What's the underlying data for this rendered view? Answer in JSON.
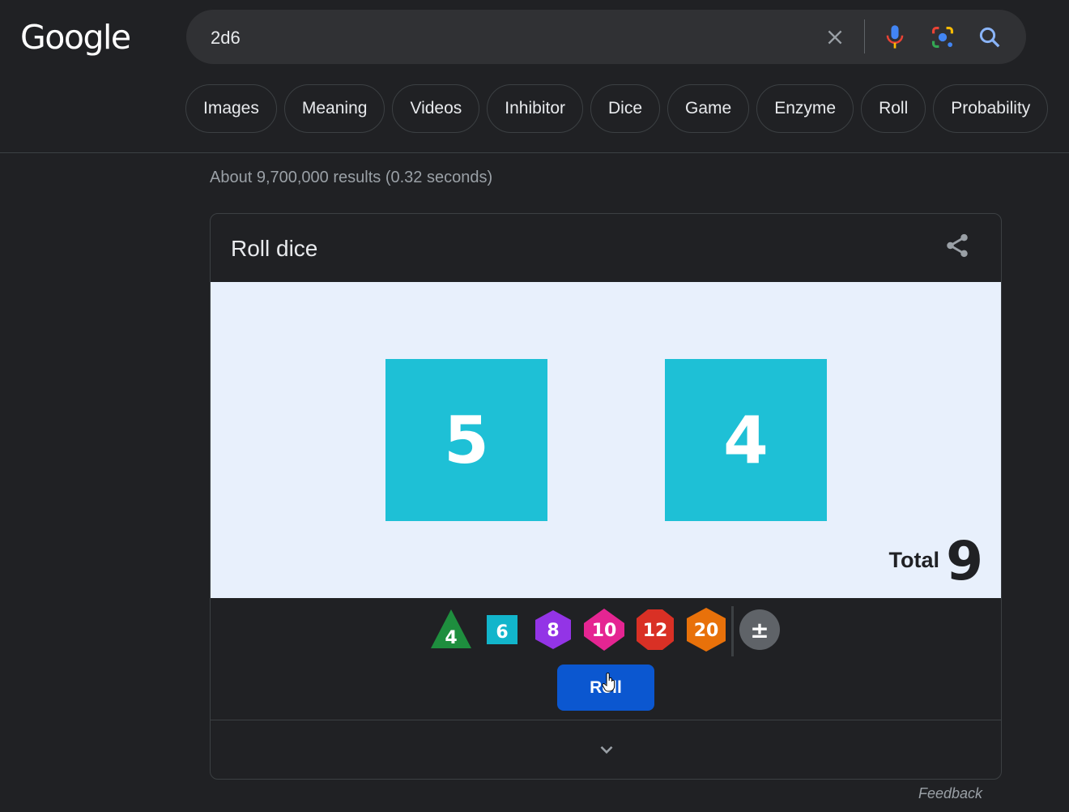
{
  "header": {
    "logo": "Google",
    "search_query": "2d6"
  },
  "chips": [
    "Images",
    "Meaning",
    "Videos",
    "Inhibitor",
    "Dice",
    "Game",
    "Enzyme",
    "Roll",
    "Probability"
  ],
  "results_stats": "About 9,700,000 results (0.32 seconds)",
  "card": {
    "title": "Roll dice",
    "dice_values": [
      "5",
      "4"
    ],
    "total_label": "Total",
    "total_value": "9",
    "dice_types": [
      {
        "label": "4",
        "shape": "triangle",
        "color": "#1e8e3e"
      },
      {
        "label": "6",
        "shape": "square",
        "color": "#12b5cb"
      },
      {
        "label": "8",
        "shape": "hexagon",
        "color": "#9334e6"
      },
      {
        "label": "10",
        "shape": "pentagon",
        "color": "#e52592"
      },
      {
        "label": "12",
        "shape": "decagon",
        "color": "#d93025"
      },
      {
        "label": "20",
        "shape": "hexagon",
        "color": "#e8710a"
      }
    ],
    "modifier_label": "±",
    "roll_label": "Roll"
  },
  "feedback": "Feedback",
  "colors": {
    "background": "#202124",
    "die_face": "#1ec0d6",
    "dice_area": "#e8f0fc",
    "roll_button": "#0b57d0"
  }
}
